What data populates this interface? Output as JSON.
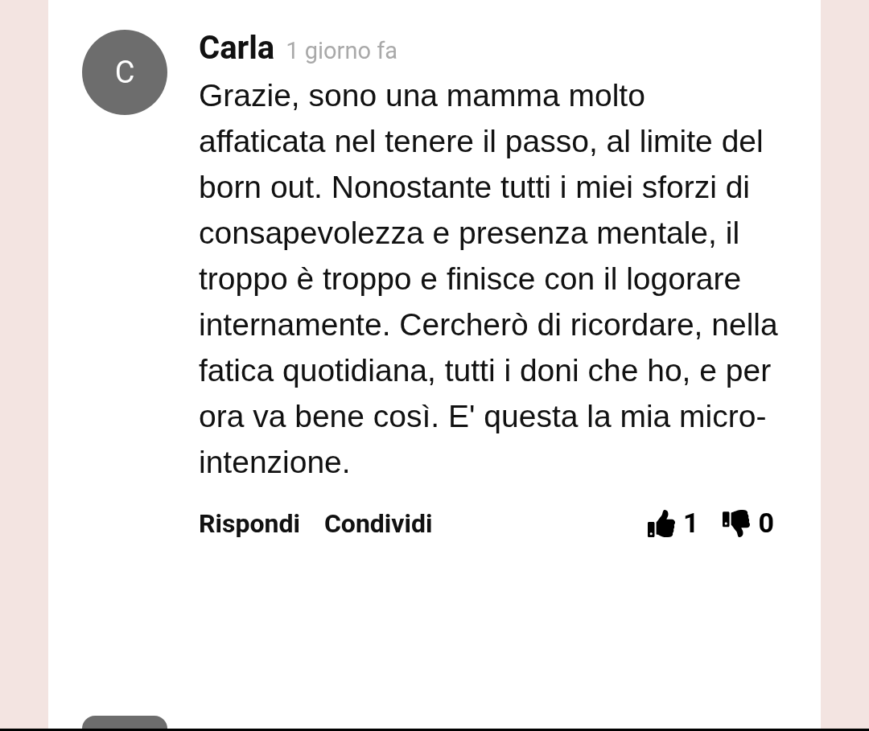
{
  "comment": {
    "avatar_letter": "C",
    "author": "Carla",
    "time": "1 giorno fa",
    "body": "Grazie, sono una mamma molto affaticata nel tenere il passo, al limite del born out. Nonostante tutti i miei sforzi di consapevolezza e presenza mentale, il troppo è troppo e finisce con il logorare internamente. Cercherò di ricordare, nella fatica quotidiana, tutti i doni che ho, e per ora va bene così. E' questa la mia micro-intenzione.",
    "actions": [
      "Rispondi",
      "Condividi"
    ],
    "likes": "1",
    "dislikes": "0"
  },
  "next_comment": {
    "kind": "partial"
  }
}
